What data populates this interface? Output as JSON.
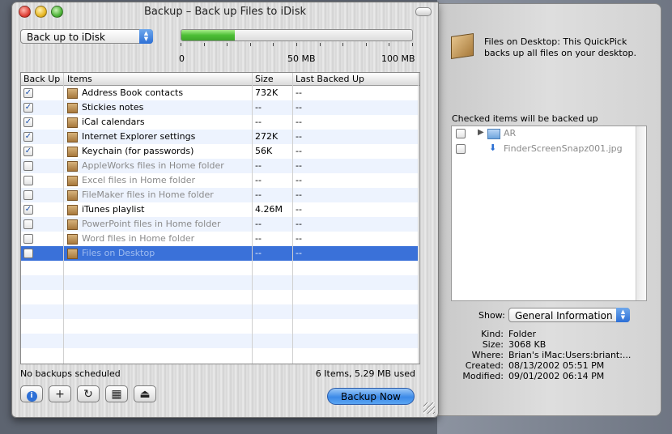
{
  "window": {
    "title": "Backup – Back up Files to iDisk"
  },
  "destination": {
    "selected": "Back up to iDisk"
  },
  "capacity": {
    "used_fraction": 0.23,
    "scale_labels": [
      "0",
      "50 MB",
      "100 MB"
    ]
  },
  "table": {
    "columns": [
      "Back Up",
      "Items",
      "Size",
      "Last Backed Up"
    ],
    "rows": [
      {
        "checked": true,
        "name": "Address Book contacts",
        "size": "732K",
        "last": "--",
        "dimmed": false
      },
      {
        "checked": true,
        "name": "Stickies notes",
        "size": "--",
        "last": "--",
        "dimmed": false
      },
      {
        "checked": true,
        "name": "iCal calendars",
        "size": "--",
        "last": "--",
        "dimmed": false
      },
      {
        "checked": true,
        "name": "Internet Explorer settings",
        "size": "272K",
        "last": "--",
        "dimmed": false
      },
      {
        "checked": true,
        "name": "Keychain (for passwords)",
        "size": "56K",
        "last": "--",
        "dimmed": false
      },
      {
        "checked": false,
        "name": "AppleWorks files in Home folder",
        "size": "--",
        "last": "--",
        "dimmed": true
      },
      {
        "checked": false,
        "name": "Excel files in Home folder",
        "size": "--",
        "last": "--",
        "dimmed": true
      },
      {
        "checked": false,
        "name": "FileMaker files in Home folder",
        "size": "--",
        "last": "--",
        "dimmed": true
      },
      {
        "checked": true,
        "name": "iTunes playlist",
        "size": "4.26M",
        "last": "--",
        "dimmed": false
      },
      {
        "checked": false,
        "name": "PowerPoint files in Home folder",
        "size": "--",
        "last": "--",
        "dimmed": true
      },
      {
        "checked": false,
        "name": "Word files in Home folder",
        "size": "--",
        "last": "--",
        "dimmed": true
      },
      {
        "checked": false,
        "name": "Files on Desktop",
        "size": "--",
        "last": "--",
        "dimmed": true,
        "selected": true
      }
    ]
  },
  "status": {
    "schedule": "No backups scheduled",
    "summary": "6 Items, 5.29 MB used"
  },
  "toolbar": {
    "info_icon": "info-icon",
    "add_icon": "plus-icon",
    "refresh_icon": "refresh-icon",
    "calendar_icon": "calendar-icon",
    "eject_icon": "eject-icon",
    "info_glyph": "i",
    "add_glyph": "+",
    "refresh_glyph": "↻",
    "calendar_glyph": "▦",
    "eject_glyph": "⏏",
    "backup_now": "Backup Now"
  },
  "drawer": {
    "description": "Files on Desktop:  This QuickPick backs up all files on your desktop.",
    "list_heading": "Checked items will be backed up",
    "items": [
      {
        "name": "AR",
        "type": "folder"
      },
      {
        "name": "FinderScreenSnapz001.jpg",
        "type": "file"
      }
    ],
    "show_label": "Show:",
    "show_selected": "General Information",
    "info": [
      {
        "key": "Kind:",
        "value": "Folder"
      },
      {
        "key": "Size:",
        "value": "3068 KB"
      },
      {
        "key": "Where:",
        "value": "Brian's iMac:Users:briant:..."
      },
      {
        "key": "Created:",
        "value": "08/13/2002 05:51 PM"
      },
      {
        "key": "Modified:",
        "value": "09/01/2002 06:14 PM"
      }
    ]
  },
  "colors": {
    "selection": "#3a71d9",
    "alt_row": "#edf3fe",
    "progress": "#4cbf35"
  }
}
